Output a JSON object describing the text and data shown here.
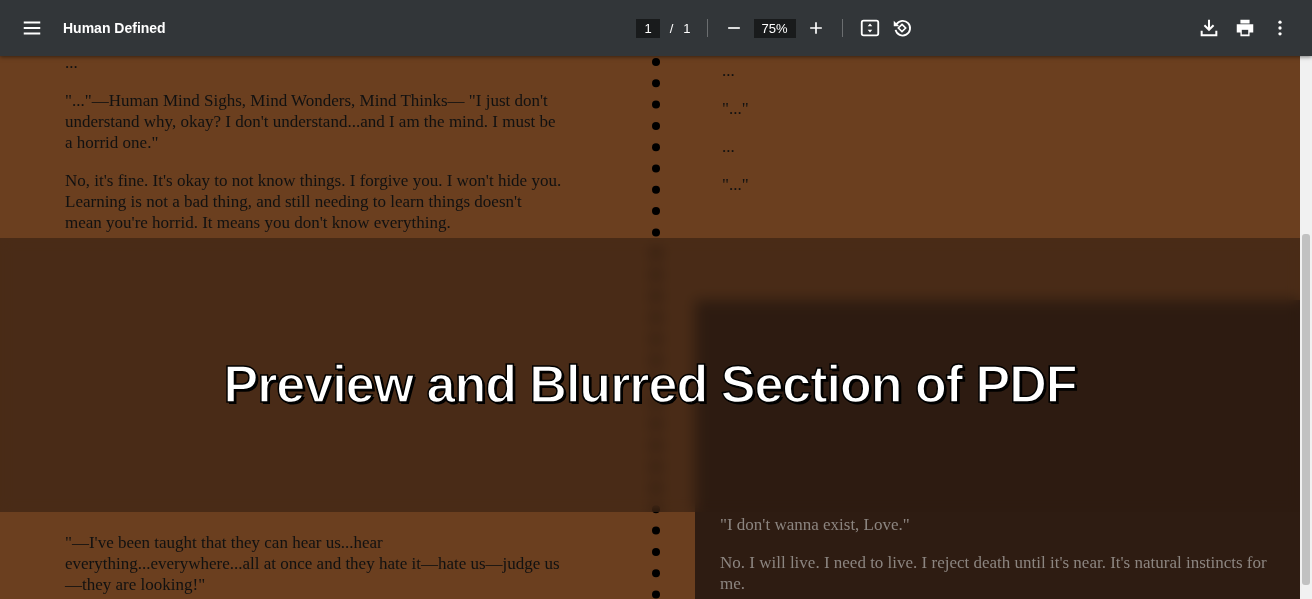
{
  "toolbar": {
    "title": "Human Defined",
    "page_current": "1",
    "page_separator": "/",
    "page_total": "1",
    "zoom": "75%"
  },
  "left_page": {
    "top_paragraphs": [
      "...",
      "\"...\"—Human Mind Sighs, Mind Wonders, Mind Thinks— \"I just don't understand why, okay? I don't understand...and I am the mind. I must be a horrid one.\"",
      "No, it's fine. It's okay to not know things. I forgive you. I won't hide you. Learning is not a bad thing, and still needing to learn things doesn't mean you're horrid. It means you don't know everything."
    ],
    "bottom_paragraphs": [
      "\"—I've been taught that they can hear us...hear everything...everywhere...all at once and they hate it—hate us—judge us—they are looking!\""
    ]
  },
  "right_page": {
    "top_paragraphs": [
      "...",
      "\"...\"",
      "...",
      "\"...\""
    ],
    "bottom_paragraphs": [
      "\"I don't wanna exist, Love.\"",
      "No. I will live. I need to live. I reject death until it's near. It's natural instincts for me."
    ]
  },
  "overlay_banner": "Preview and Blurred Section of PDF"
}
